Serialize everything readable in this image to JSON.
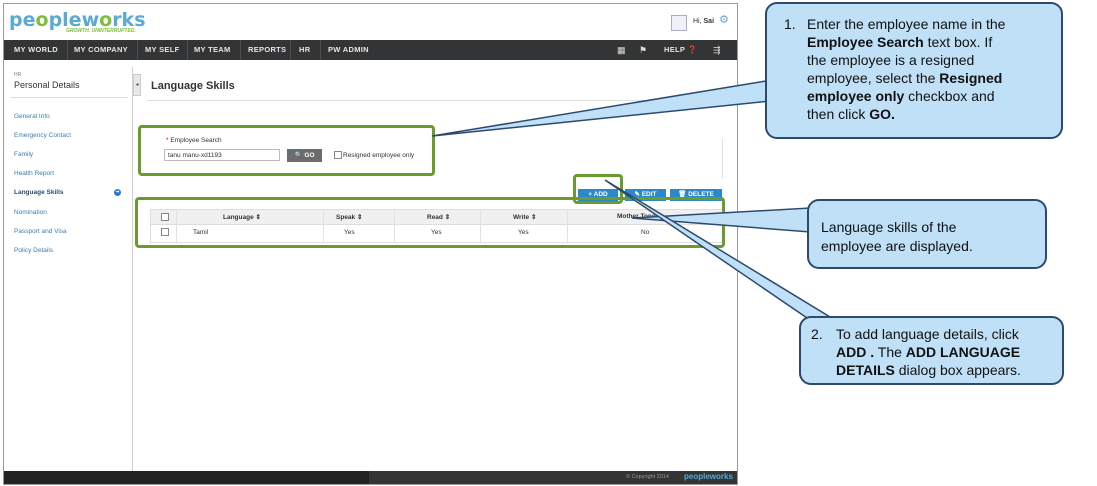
{
  "app": {
    "logo": {
      "part1": "pe",
      "part2": "o",
      "part3": "ple",
      "part4": "w",
      "part5": "o",
      "part6": "rks"
    },
    "tagline": "GROWTH. UNINTERRUPTED.",
    "greeting_prefix": "Hi,",
    "user_name": "Sai"
  },
  "nav": {
    "items": [
      "MY WORLD",
      "MY COMPANY",
      "MY SELF",
      "MY TEAM",
      "REPORTS",
      "HR",
      "PW ADMIN"
    ],
    "help_label": "HELP",
    "icons": [
      "list-icon",
      "flag-icon",
      "help-icon",
      "share-icon"
    ]
  },
  "sidebar": {
    "section": "HR",
    "title": "Personal Details",
    "items": [
      {
        "label": "General Info"
      },
      {
        "label": "Emergency Contact"
      },
      {
        "label": "Family"
      },
      {
        "label": "Health Report"
      },
      {
        "label": "Language Skills",
        "active": true
      },
      {
        "label": "Nomination"
      },
      {
        "label": "Passport and Visa"
      },
      {
        "label": "Policy Details"
      }
    ]
  },
  "main": {
    "title": "Language Skills",
    "search": {
      "label": "Employee Search",
      "value": "tanu manu-xd1193",
      "go_label": "GO",
      "resigned_label": "Resigned employee only"
    },
    "buttons": {
      "add": "ADD",
      "edit": "EDIT",
      "delete": "DELETE"
    },
    "table": {
      "headers": [
        "Language",
        "Speak",
        "Read",
        "Write",
        "Mother Tongue"
      ],
      "rows": [
        {
          "language": "Tamil",
          "speak": "Yes",
          "read": "Yes",
          "write": "Yes",
          "mother_tongue": "No"
        }
      ]
    }
  },
  "footer": {
    "copyright": "© Copyright 2014",
    "brand": "peopleworks"
  },
  "callouts": {
    "c1": {
      "num": "1.",
      "l1": "Enter the employee name in the",
      "l2a": "Employee Search",
      "l2b": " text box. If",
      "l3": "the employee is a resigned",
      "l4a": "employee, select  the ",
      "l4b": "Resigned",
      "l5a": "employee only",
      "l5b": " checkbox and",
      "l6a": "then  click ",
      "l6b": "GO."
    },
    "c2": {
      "l1": "Language skills of the",
      "l2": "employee are displayed."
    },
    "c3": {
      "num": "2.",
      "l1": "To add language details, click",
      "l2a": "ADD .",
      "l2b": " The ",
      "l2c": "ADD LANGUAGE",
      "l3a": "DETAILS",
      "l3b": " dialog box appears."
    }
  },
  "colors": {
    "accent": "#2b89c9",
    "nav_bg": "#333436",
    "highlight": "#6a9b2e",
    "callout_bg": "#bfe0f7",
    "callout_border": "#2d4a6e"
  }
}
